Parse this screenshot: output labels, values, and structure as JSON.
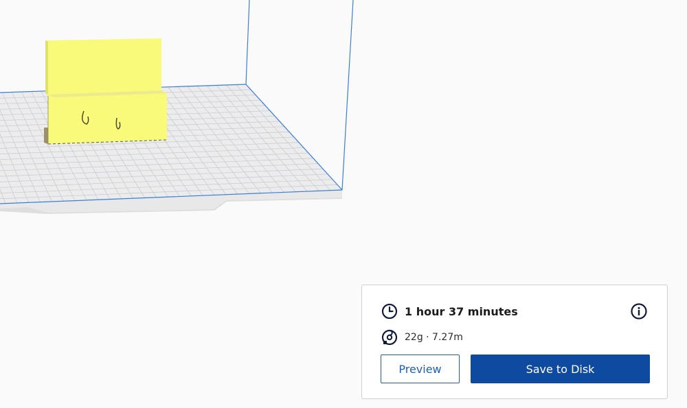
{
  "viewport": {
    "background_color": "#fafafa",
    "build_volume_edge_color": "#3a7ed8",
    "build_plate_color": "#ececec",
    "grid_line_color": "#c8cdd3",
    "model_color": "#fafa7a",
    "model_shadow_color": "#c9c98f"
  },
  "print_panel": {
    "time_icon": "clock-icon",
    "print_time": "1 hour 37 minutes",
    "info_icon": "info-icon",
    "material_icon": "filament-spool-icon",
    "material_usage": "22g · 7.27m",
    "preview_label": "Preview",
    "save_label": "Save to Disk",
    "accent_color": "#0e4aa0"
  }
}
